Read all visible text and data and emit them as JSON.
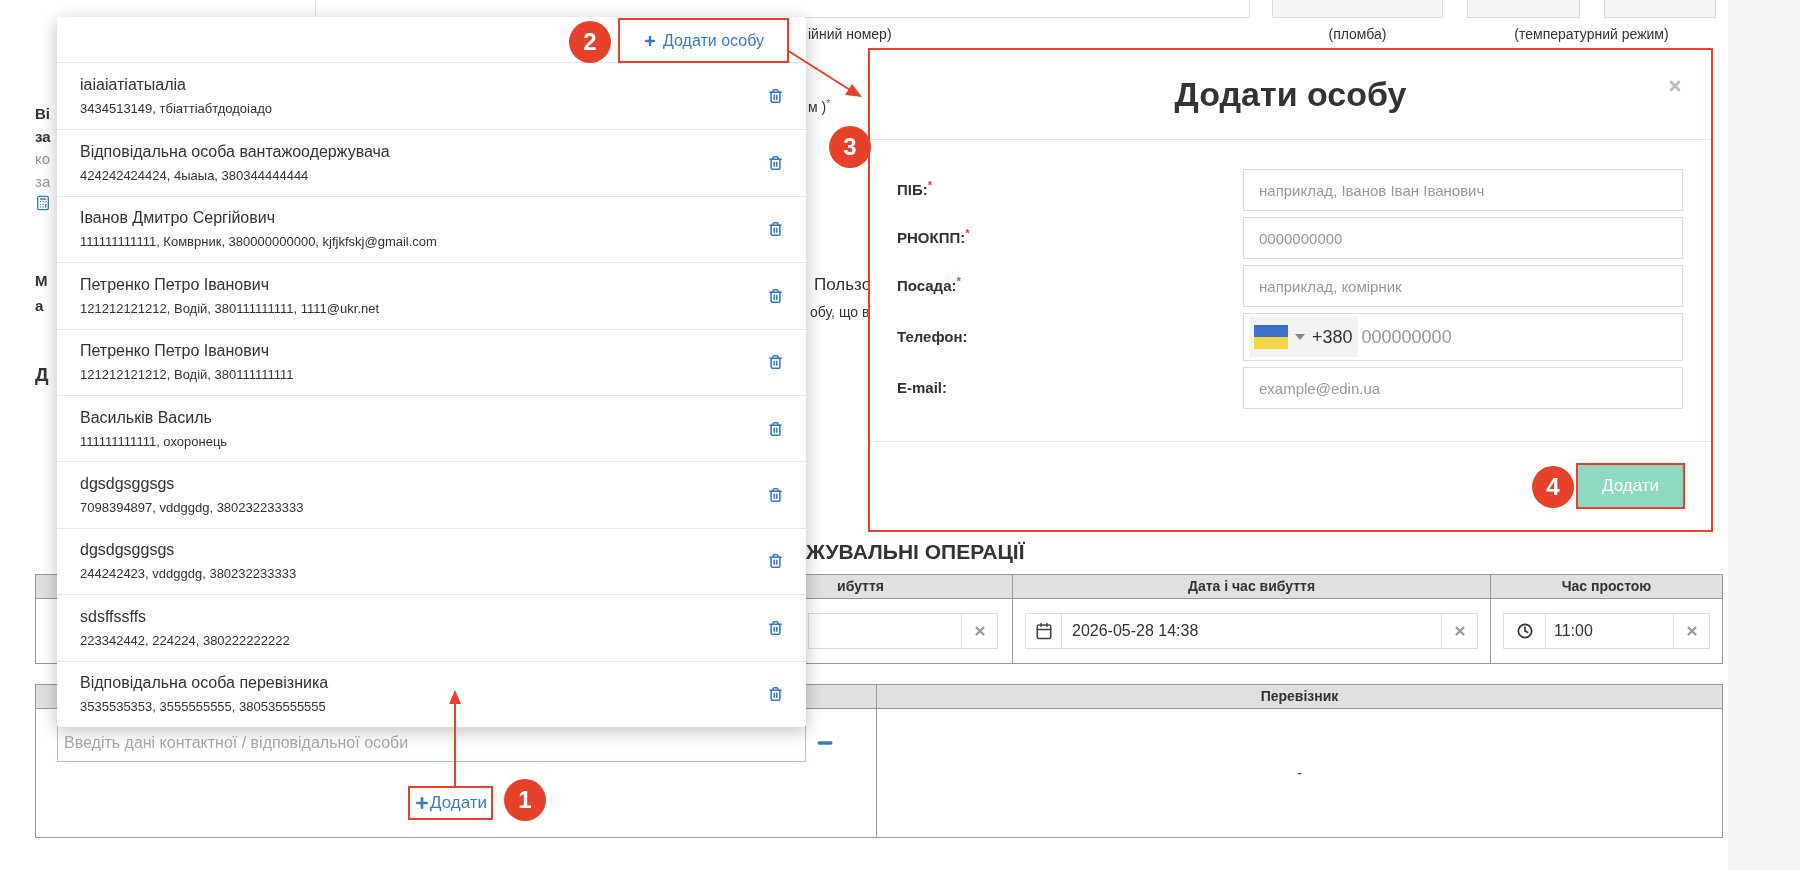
{
  "top_labels": [
    "ійний номер)",
    "(пломба)",
    "(температурний режим)"
  ],
  "left_fragments": [
    {
      "kind": "label",
      "text": "Ві"
    },
    {
      "kind": "label",
      "text": "за"
    },
    {
      "kind": "hint",
      "text": "ко"
    },
    {
      "kind": "hint",
      "text": "за"
    },
    {
      "kind": "label",
      "text": "М"
    },
    {
      "kind": "label",
      "text": "а"
    },
    {
      "kind": "heading",
      "text": "Д"
    }
  ],
  "side_fragments": [
    "м )$^{*}$",
    "Пользо",
    "обу, що в"
  ],
  "section_heading": "ЖУВАЛЬНІ ОПЕРАЦІЇ",
  "times_table": {
    "columns": [
      "ибуття",
      "Дата і час вибуття",
      "Час простою"
    ],
    "departure": "2026-05-28 14:38",
    "idle_time": "11:00"
  },
  "contacts_table": {
    "columns": [
      "Перевізник"
    ],
    "contact_input": {
      "placeholder": "Введіть дані контактної / відповідальної особи"
    },
    "add_button": "Додати",
    "carrier_value": "-"
  },
  "person_dropdown": {
    "add_button": "Додати особу",
    "items": [
      {
        "name": "iaiaiатiатыaлia",
        "details": "3434513149, тбiаттiабтдодоiадо"
      },
      {
        "name": "Відповідальна особа вантажоодержувача",
        "details": "424242424424, 4ыаыа, 380344444444"
      },
      {
        "name": "Іванов Дмитро Сергійович",
        "details": "111111111111, Комврник, 380000000000, kjfjkfskj@gmail.com"
      },
      {
        "name": "Петренко Петро Іванович",
        "details": "121212121212, Водій, 380111111111, 1111@ukr.net"
      },
      {
        "name": "Петренко Петро Іванович",
        "details": "121212121212, Водій, 380111111111"
      },
      {
        "name": "Васильків Василь",
        "details": "111111111111, охоронець"
      },
      {
        "name": "dgsdgsggsgs",
        "details": "7098394897, vddggdg, 380232233333"
      },
      {
        "name": "dgsdgsggsgs",
        "details": "244242423, vddggdg, 380232233333"
      },
      {
        "name": "sdsffssffs",
        "details": "223342442, 224224, 380222222222"
      },
      {
        "name": "Відповідальна особа перевізника",
        "details": "3535535353, 3555555555, 380535555555"
      }
    ]
  },
  "modal": {
    "title": "Додати особу",
    "fields": [
      {
        "kind": "text",
        "label": "ПІБ:$^{*}$",
        "placeholder": "наприклад, Іванов Іван Іванович"
      },
      {
        "kind": "text",
        "label": "РНОКПП:$^{*}$",
        "placeholder": "0000000000"
      },
      {
        "kind": "text",
        "label": "Посада:$^{*}$",
        "placeholder": "наприклад, комірник"
      },
      {
        "kind": "phone",
        "label": "Телефон:",
        "country_code": "+380",
        "placeholder": "000000000"
      },
      {
        "kind": "text",
        "label": "E-mail:",
        "placeholder": "example@edin.ua"
      }
    ],
    "submit": "Додати"
  },
  "callouts": [
    "1",
    "2",
    "3",
    "4"
  ]
}
